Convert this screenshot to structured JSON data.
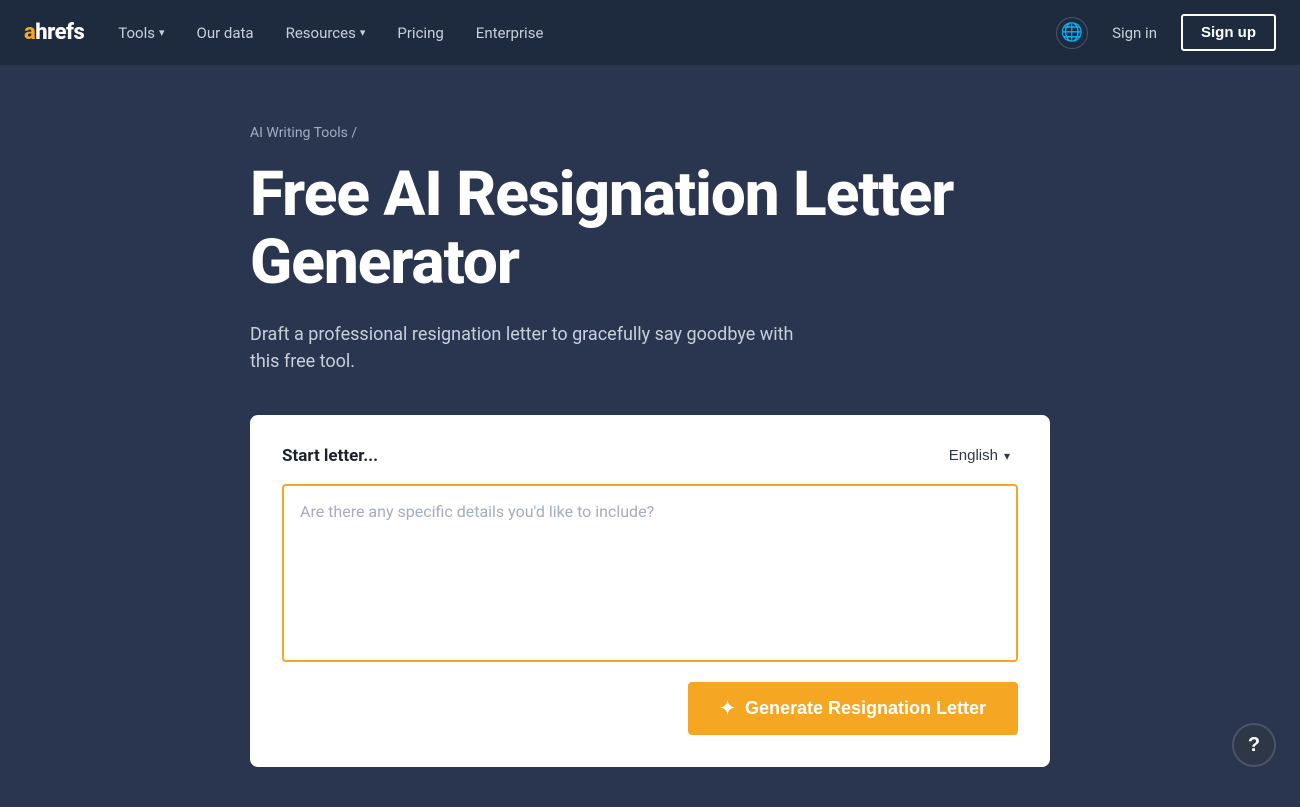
{
  "brand": {
    "logo_a": "a",
    "logo_rest": "hrefs"
  },
  "navbar": {
    "items": [
      {
        "label": "Tools",
        "has_chevron": true
      },
      {
        "label": "Our data",
        "has_chevron": false
      },
      {
        "label": "Resources",
        "has_chevron": true
      },
      {
        "label": "Pricing",
        "has_chevron": false
      },
      {
        "label": "Enterprise",
        "has_chevron": false
      }
    ],
    "sign_in": "Sign in",
    "sign_up": "Sign up",
    "globe_icon": "🌐"
  },
  "hero": {
    "breadcrumb": "AI Writing Tools /",
    "title": "Free AI Resignation Letter Generator",
    "subtitle": "Draft a professional resignation letter to gracefully say goodbye with this free tool."
  },
  "tool": {
    "card_label": "Start letter...",
    "language": "English",
    "textarea_placeholder": "Are there any specific details you'd like to include?",
    "generate_button": "Generate Resignation Letter",
    "generate_icon": "✦"
  },
  "help": {
    "label": "?"
  }
}
